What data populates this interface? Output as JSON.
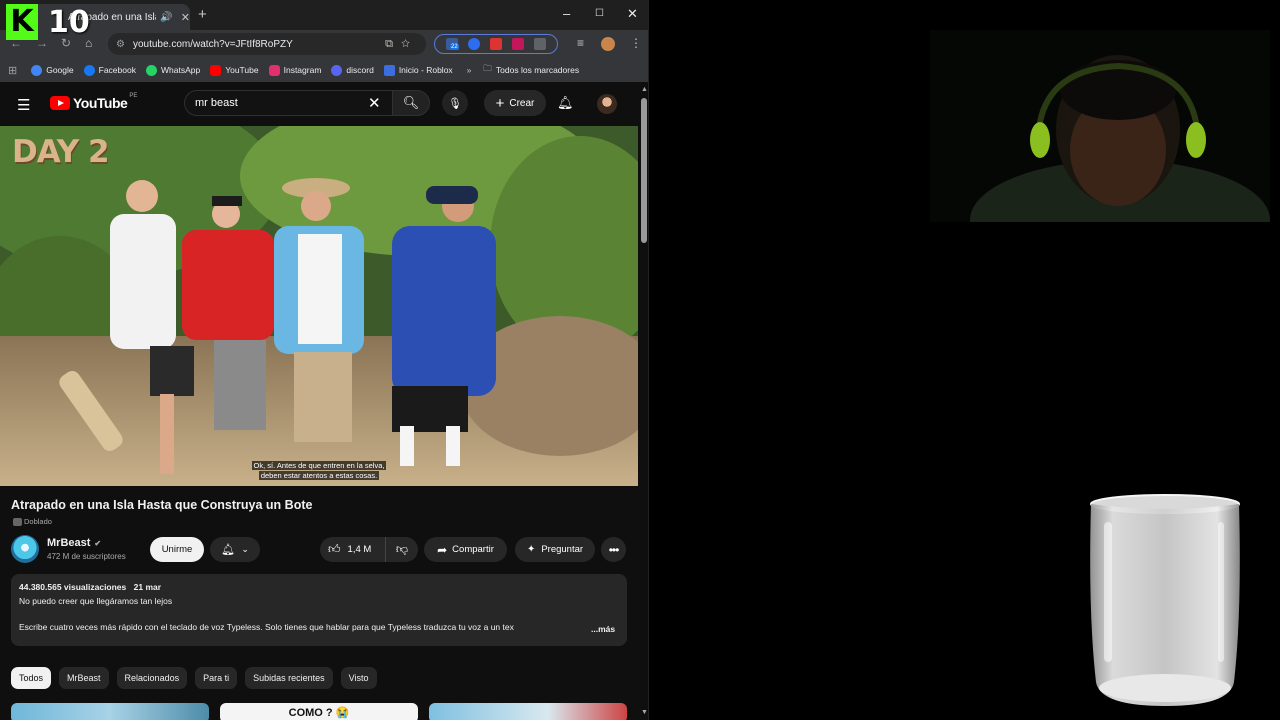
{
  "overlay": {
    "logo_letter": "K",
    "count": "10"
  },
  "browser": {
    "tab_title": "Atrapado en una Isla Hasta",
    "new_tab": "+",
    "window_controls": {
      "minimize": "–",
      "maximize": "☐",
      "close": "✕"
    },
    "url": "youtube.com/watch?v=JFtIf8RoPZY",
    "extension_badge_count": "22",
    "bookmarks": [
      {
        "label": "Google",
        "color": "#4285f4"
      },
      {
        "label": "Facebook",
        "color": "#1877f2"
      },
      {
        "label": "WhatsApp",
        "color": "#25d366"
      },
      {
        "label": "YouTube",
        "color": "#ff0000"
      },
      {
        "label": "Instagram",
        "color": "#e1306c"
      },
      {
        "label": "discord",
        "color": "#5865f2"
      },
      {
        "label": "Inicio - Roblox",
        "color": "#3b6fe0"
      }
    ],
    "bookmarks_more": "»",
    "all_bookmarks": "Todos los marcadores"
  },
  "youtube": {
    "logo": "YouTube",
    "region": "PE",
    "search_query": "mr beast",
    "create_label": "Crear",
    "video": {
      "overlay_text": "DAY 2",
      "subtitle_line1": "Ok, sí. Antes de que entren en la selva,",
      "subtitle_line2": "deben estar atentos a estas cosas.",
      "title": "Atrapado en una Isla Hasta que Construya un Bote",
      "dubbed_label": "Doblado",
      "channel": "MrBeast",
      "subscribers": "472 M de suscriptores",
      "join_label": "Unirme",
      "likes": "1,4 M",
      "share_label": "Compartir",
      "ask_label": "Preguntar",
      "views": "44.380.565 visualizaciones",
      "date": "21 mar",
      "desc_line1": "No puedo creer que llegáramos tan lejos",
      "desc_line2": "Escribe cuatro veces más rápido con el teclado de voz Typeless. Solo tienes que hablar para que Typeless traduzca tu voz a un tex",
      "more_label": "...más"
    },
    "chips": [
      "Todos",
      "MrBeast",
      "Relacionados",
      "Para ti",
      "Subidas recientes",
      "Visto"
    ],
    "thumbnail_text": "COMO ? 😭"
  },
  "colors": {
    "kick_green": "#53fc18",
    "yt_red": "#ff0000",
    "bg": "#0f0f0f"
  }
}
